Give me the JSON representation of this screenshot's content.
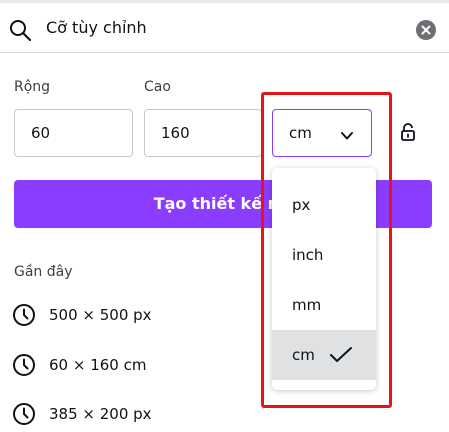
{
  "search": {
    "value": "Cỡ tùy chỉnh",
    "icon": "search-icon",
    "clear_icon": "close-icon"
  },
  "dimensions": {
    "width_label": "Rộng",
    "width_value": "60",
    "height_label": "Cao",
    "height_value": "160",
    "unit_selected": "cm",
    "lock_icon": "lock-icon"
  },
  "create_button": {
    "label": "Tạo thiết kế m"
  },
  "recent": {
    "heading": "Gần đây",
    "items": [
      {
        "label": "500 × 500 px"
      },
      {
        "label": "60 × 160 cm"
      },
      {
        "label": "385 × 200 px"
      }
    ]
  },
  "unit_dropdown": {
    "options": [
      {
        "label": "px",
        "selected": false
      },
      {
        "label": "inch",
        "selected": false
      },
      {
        "label": "mm",
        "selected": false
      },
      {
        "label": "cm",
        "selected": true
      }
    ]
  },
  "colors": {
    "accent": "#8b3dff",
    "highlight": "#e8141c",
    "selected_bg": "#dfe1e3"
  }
}
